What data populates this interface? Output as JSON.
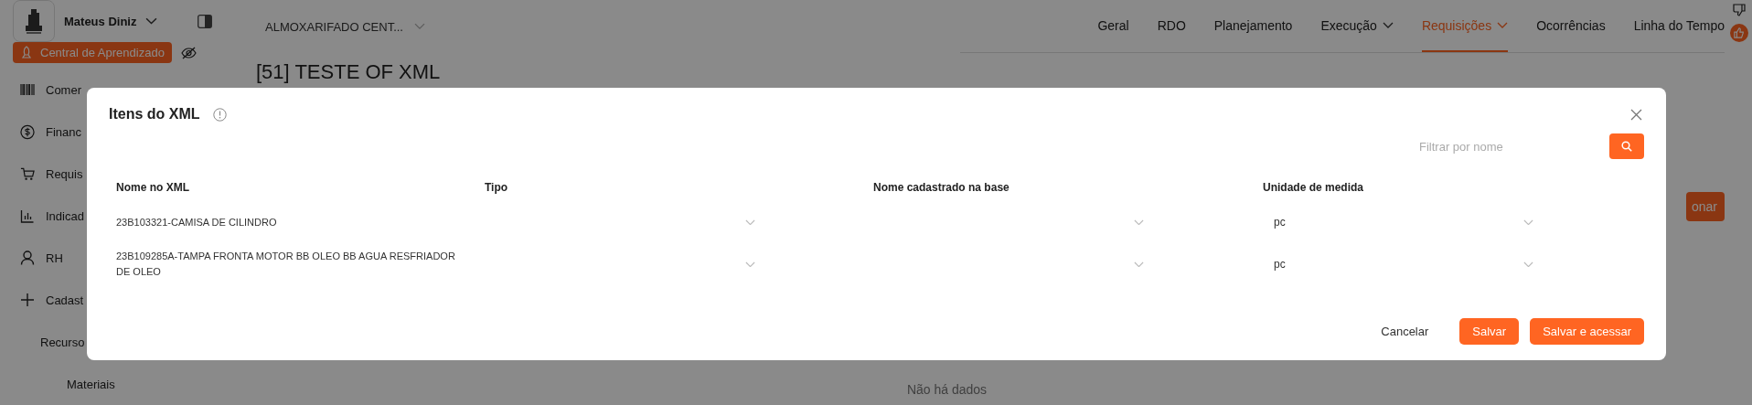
{
  "user": {
    "name": "Mateus Diniz"
  },
  "project_selector": {
    "value": "ALMOXARIFADO CENT..."
  },
  "learning_badge": {
    "label": "Central de Aprendizado"
  },
  "sidebar": {
    "items": [
      {
        "label": "Comer"
      },
      {
        "label": "Financ"
      },
      {
        "label": "Requis"
      },
      {
        "label": "Indicad"
      },
      {
        "label": "RH"
      },
      {
        "label": "Cadast",
        "children": [
          {
            "label": "Recurso",
            "children": [
              {
                "label": "Materiais"
              }
            ]
          }
        ]
      }
    ]
  },
  "nav_tabs": [
    {
      "label": "Geral",
      "selected": false,
      "dropdown": false
    },
    {
      "label": "RDO",
      "selected": false,
      "dropdown": false
    },
    {
      "label": "Planejamento",
      "selected": false,
      "dropdown": false
    },
    {
      "label": "Execução",
      "selected": false,
      "dropdown": true
    },
    {
      "label": "Requisições",
      "selected": true,
      "dropdown": true
    },
    {
      "label": "Ocorrências",
      "selected": false,
      "dropdown": false
    },
    {
      "label": "Linha do Tempo",
      "selected": false,
      "dropdown": false
    }
  ],
  "page": {
    "title": "[51] TESTE OF XML",
    "add_button": "onar",
    "empty_text": "Não há dados"
  },
  "modal": {
    "title": "Itens do XML",
    "filter": {
      "placeholder": "Filtrar por nome"
    },
    "table": {
      "columns": [
        "Nome no XML",
        "Tipo",
        "Nome cadastrado na base",
        "Unidade de medida"
      ],
      "rows": [
        {
          "nome_no_xml": "23B103321-CAMISA DE CILINDRO",
          "unidade_de_medida": "pc"
        },
        {
          "nome_no_xml": "23B109285A-TAMPA FRONTA MOTOR BB OLEO BB AGUA RESFRIADOR DE OLEO",
          "unidade_de_medida": "pc"
        }
      ]
    },
    "buttons": [
      {
        "label": "Cancelar",
        "kind": "text"
      },
      {
        "label": "Salvar",
        "kind": "primary"
      },
      {
        "label": "Salvar e acessar",
        "kind": "primary"
      }
    ]
  }
}
